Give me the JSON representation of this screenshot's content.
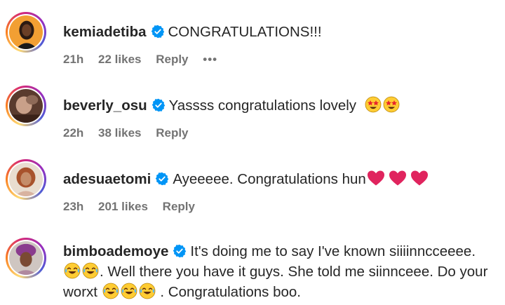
{
  "comments": [
    {
      "username": "kemiadetiba",
      "text": "CONGRATULATIONS!!!",
      "time": "21h",
      "likes": "22 likes",
      "reply": "Reply",
      "more": "•••"
    },
    {
      "username": "beverly_osu",
      "text": "Yassss congratulations lovely",
      "time": "22h",
      "likes": "38 likes",
      "reply": "Reply"
    },
    {
      "username": "adesuaetomi",
      "text": "Ayeeeee. Congratulations hun",
      "time": "23h",
      "likes": "201 likes",
      "reply": "Reply"
    },
    {
      "username": "bimboademoye",
      "text_part1": "It's doing me to say I've known siiiinncceeee.",
      "text_part2": ". Well there you have it guys. She told me siinnceee. Do your worxt",
      "text_part3": ". Congratulations boo."
    }
  ],
  "icons": {
    "verified": "verified-badge-icon",
    "star_struck": "star-struck-emoji",
    "heart": "red-heart-emoji",
    "laughing": "tears-of-joy-emoji"
  },
  "colors": {
    "verified": "#0095f6",
    "meta_text": "#737373",
    "heart": "#e0245e"
  }
}
